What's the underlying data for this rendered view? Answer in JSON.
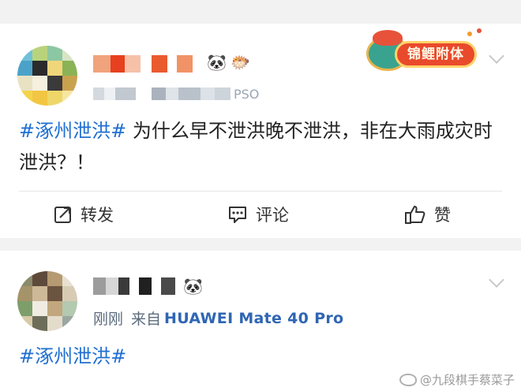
{
  "posts": [
    {
      "source_tail": "PSO",
      "badge_text": "锦鲤附体",
      "topic": "#涿州泄洪#",
      "body": " 为什么早不泄洪晚不泄洪，非在大雨成灾时泄洪？！",
      "actions": {
        "repost": "转发",
        "comment": "评论",
        "like": "赞"
      }
    },
    {
      "time": "刚刚",
      "source_prefix": "来自",
      "source": "HUAWEI Mate 40 Pro",
      "topic": "#涿州泄洪#"
    }
  ],
  "emoji": {
    "panda": "🐼",
    "fish": "🐡"
  },
  "watermark": "@九段棋手蔡菜子",
  "colors": {
    "topic_blue": "#1f6fd1",
    "background": "#f2f2f2",
    "card": "#ffffff"
  },
  "icons": [
    "repost-icon",
    "comment-icon",
    "like-icon",
    "chevron-down-icon",
    "weibo-logo-icon"
  ]
}
